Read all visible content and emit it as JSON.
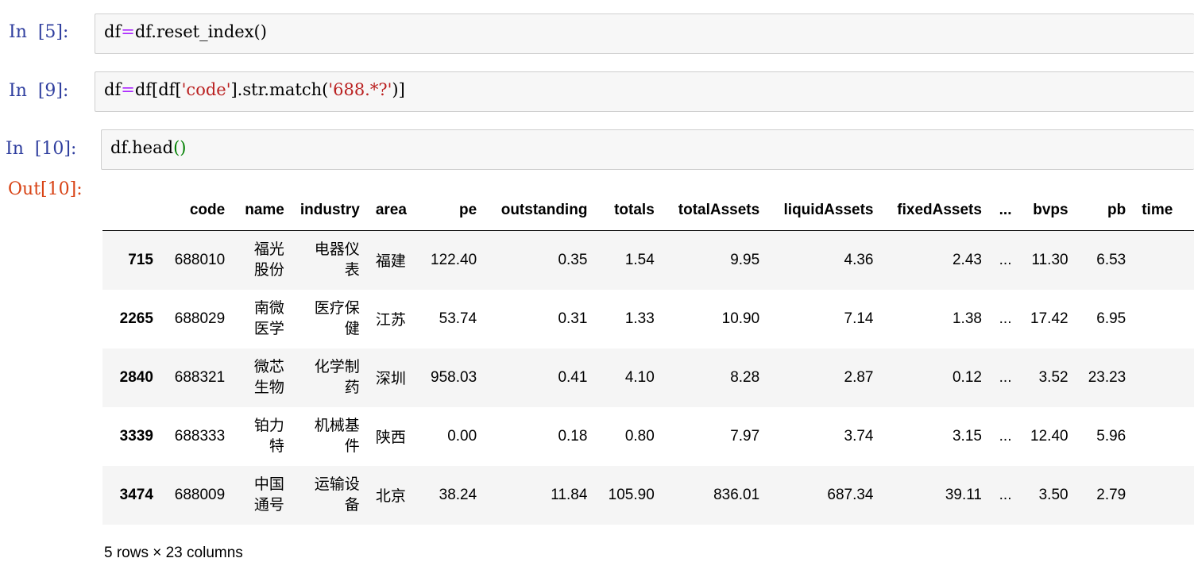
{
  "cells": [
    {
      "prompt": "In  [5]:",
      "code": {
        "a": "df",
        "op": "=",
        "b": "df.reset_index",
        "paren": "()"
      }
    },
    {
      "prompt": "In  [9]:",
      "code": {
        "a": "df",
        "op": "=",
        "b": "df[df[",
        "s1": "'code'",
        "c": "].str.match(",
        "s2": "'688.*?'",
        "d": ")]"
      }
    },
    {
      "prompt": "In  [10]:",
      "code": {
        "a": "df.head",
        "paren": "()"
      }
    }
  ],
  "output_prompt": "Out[10]:",
  "table": {
    "columns": [
      "",
      "code",
      "name",
      "industry",
      "area",
      "pe",
      "outstanding",
      "totals",
      "totalAssets",
      "liquidAssets",
      "fixedAssets",
      "...",
      "bvps",
      "pb",
      "time"
    ],
    "rows": [
      {
        "idx": "715",
        "code": "688010",
        "name": "福光股份",
        "industry": "电器仪表",
        "area": "福建",
        "pe": "122.40",
        "outstanding": "0.35",
        "totals": "1.54",
        "totalAssets": "9.95",
        "liquidAssets": "4.36",
        "fixedAssets": "2.43",
        "dots": "...",
        "bvps": "11.30",
        "pb": "6.53"
      },
      {
        "idx": "2265",
        "code": "688029",
        "name": "南微医学",
        "industry": "医疗保健",
        "area": "江苏",
        "pe": "53.74",
        "outstanding": "0.31",
        "totals": "1.33",
        "totalAssets": "10.90",
        "liquidAssets": "7.14",
        "fixedAssets": "1.38",
        "dots": "...",
        "bvps": "17.42",
        "pb": "6.95"
      },
      {
        "idx": "2840",
        "code": "688321",
        "name": "微芯生物",
        "industry": "化学制药",
        "area": "深圳",
        "pe": "958.03",
        "outstanding": "0.41",
        "totals": "4.10",
        "totalAssets": "8.28",
        "liquidAssets": "2.87",
        "fixedAssets": "0.12",
        "dots": "...",
        "bvps": "3.52",
        "pb": "23.23"
      },
      {
        "idx": "3339",
        "code": "688333",
        "name": "铂力特",
        "industry": "机械基件",
        "area": "陕西",
        "pe": "0.00",
        "outstanding": "0.18",
        "totals": "0.80",
        "totalAssets": "7.97",
        "liquidAssets": "3.74",
        "fixedAssets": "3.15",
        "dots": "...",
        "bvps": "12.40",
        "pb": "5.96"
      },
      {
        "idx": "3474",
        "code": "688009",
        "name": "中国通号",
        "industry": "运输设备",
        "area": "北京",
        "pe": "38.24",
        "outstanding": "11.84",
        "totals": "105.90",
        "totalAssets": "836.01",
        "liquidAssets": "687.34",
        "fixedAssets": "39.11",
        "dots": "...",
        "bvps": "3.50",
        "pb": "2.79"
      }
    ]
  },
  "footer": "5 rows × 23 columns"
}
